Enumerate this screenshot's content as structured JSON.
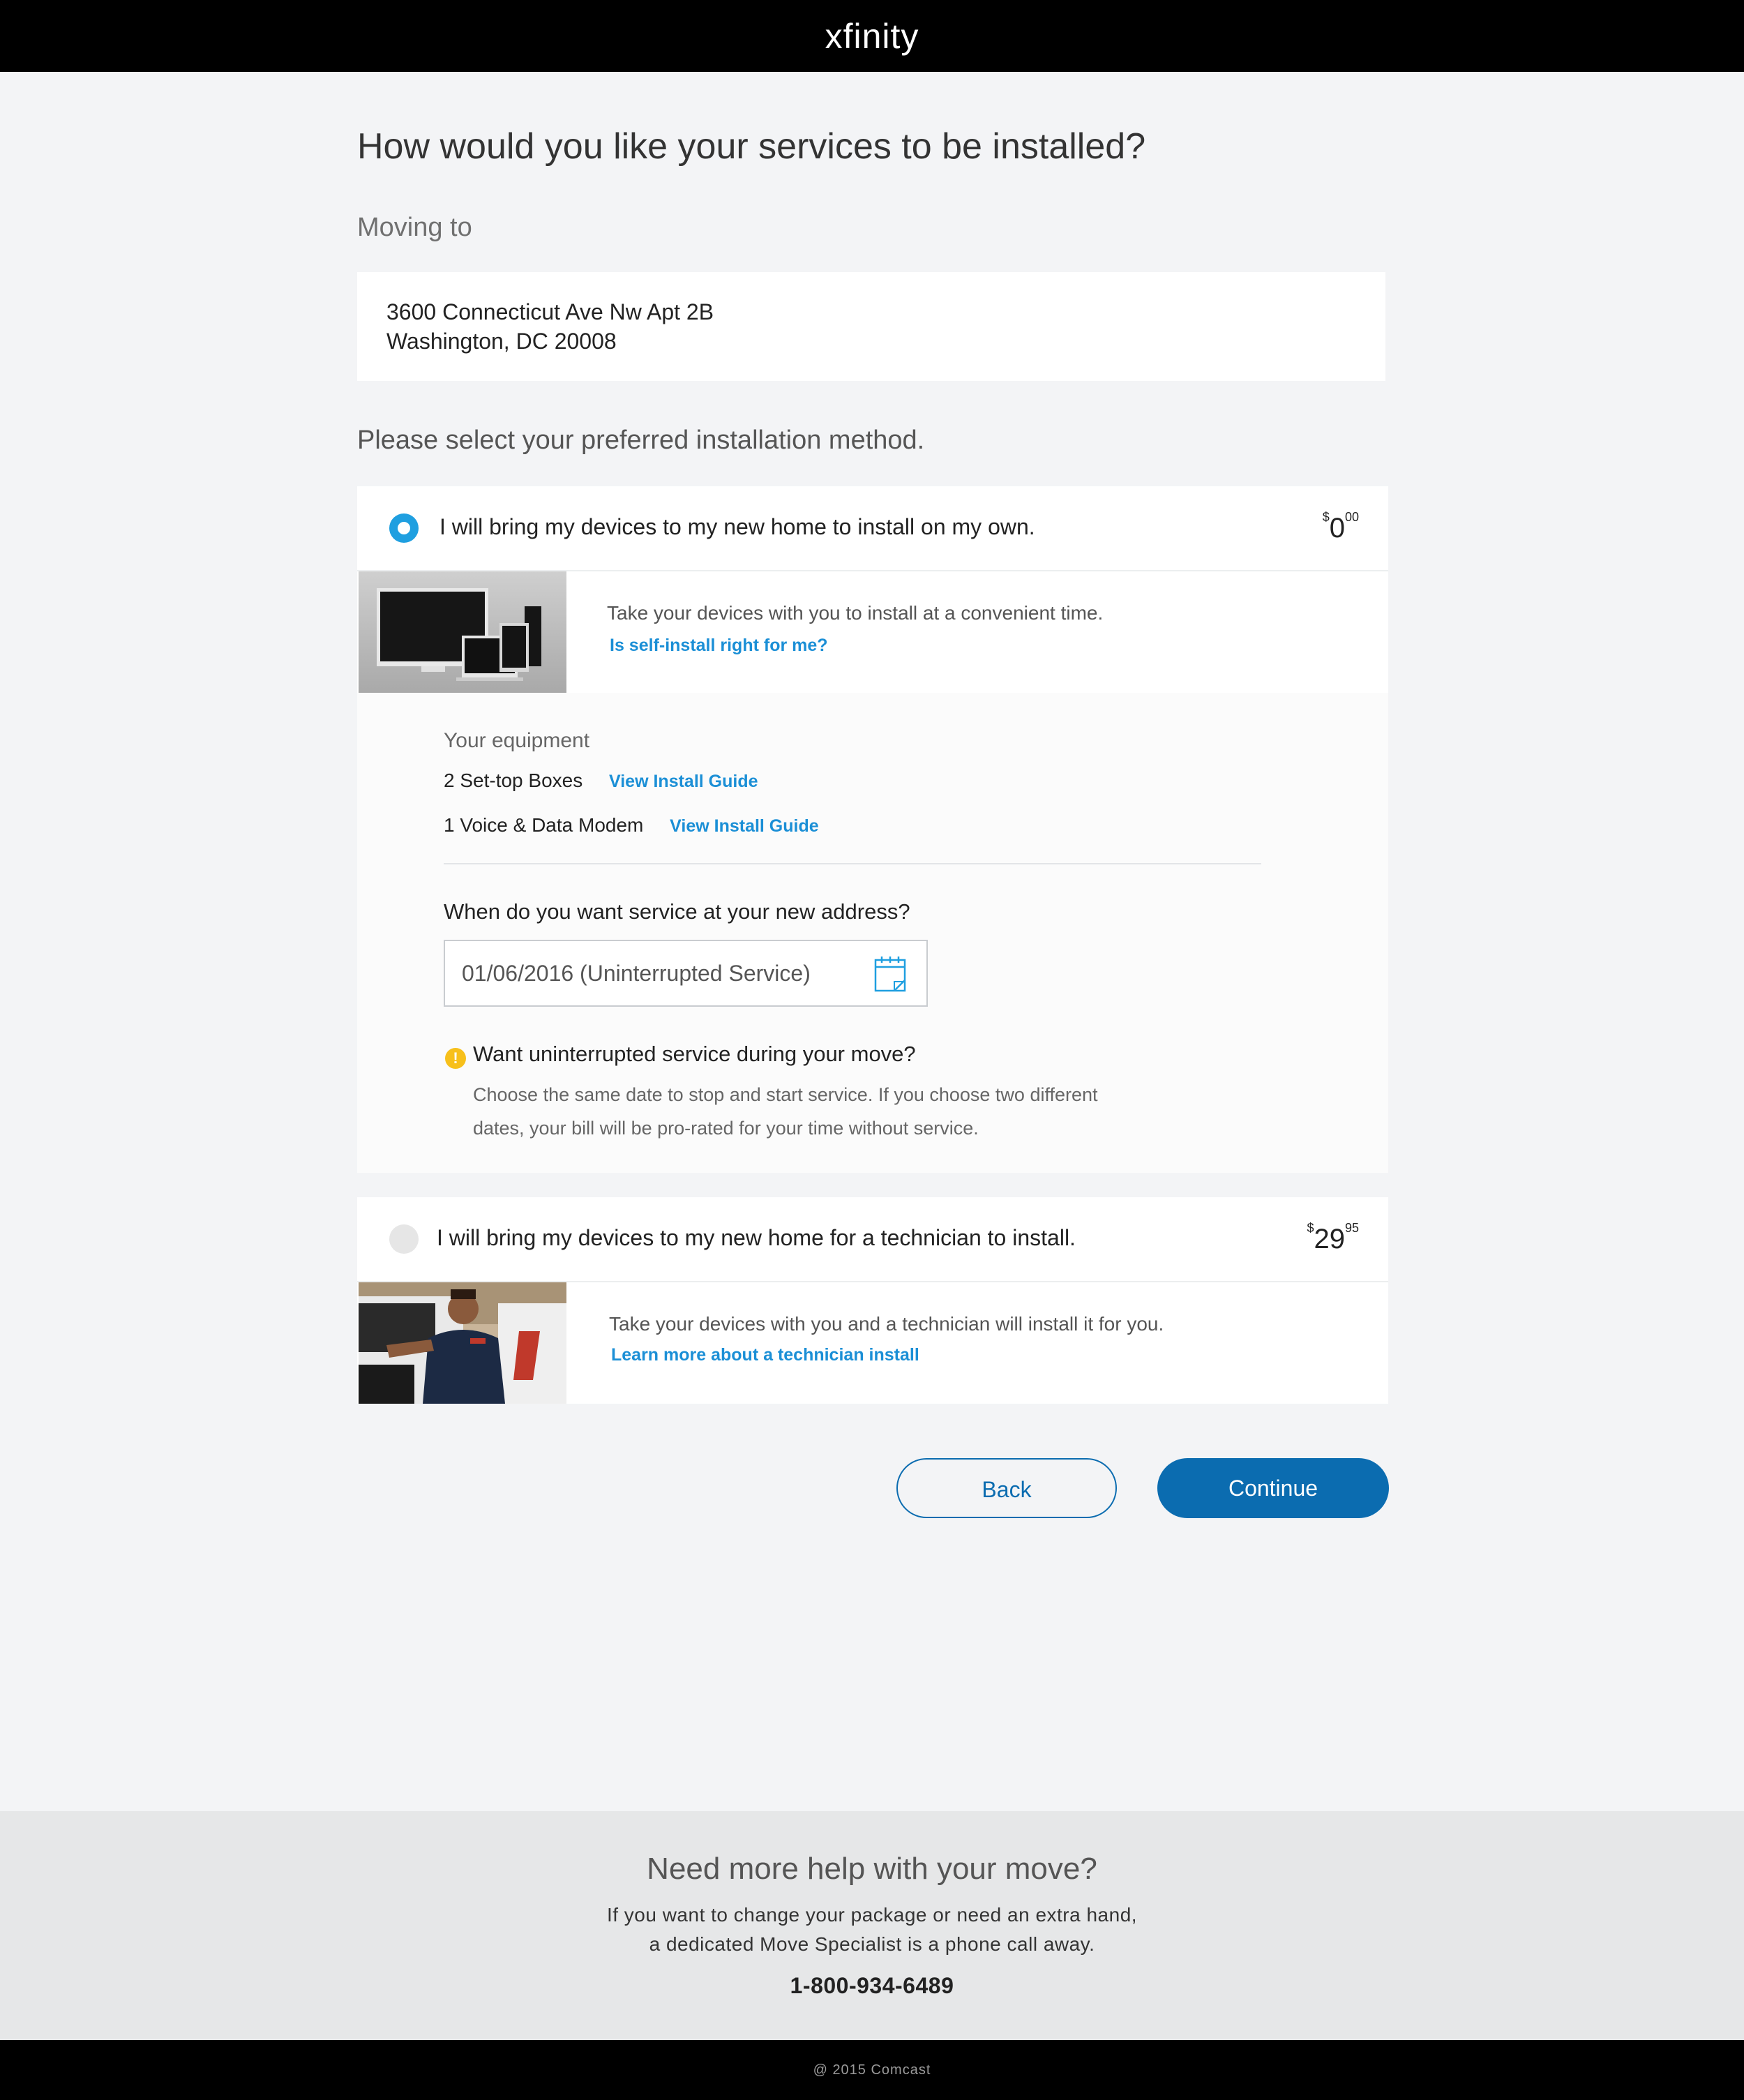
{
  "header": {
    "logo": "xfinity"
  },
  "page": {
    "title": "How would you like your services to be installed?",
    "moving_label": "Moving to",
    "address_line1": "3600 Connecticut Ave Nw Apt 2B",
    "address_line2": "Washington, DC 20008",
    "select_label": "Please select your preferred installation method."
  },
  "options": [
    {
      "label": "I will bring my devices to my new home to install on my own.",
      "price_dollar_sign": "$",
      "price_main": "0",
      "price_cents": "00",
      "selected": true,
      "description": "Take your devices with you to install at a convenient time.",
      "link": "Is self-install right for me?"
    },
    {
      "label": "I will bring my devices to my new home for a technician to install.",
      "price_dollar_sign": "$",
      "price_main": "29",
      "price_cents": "95",
      "selected": false,
      "description": "Take your devices with you and a technician will install it for you.",
      "link": "Learn more about a technician install"
    }
  ],
  "equipment": {
    "title": "Your equipment",
    "items": [
      {
        "name": "2 Set-top Boxes",
        "link": "View Install Guide"
      },
      {
        "name": "1 Voice & Data Modem",
        "link": "View Install Guide"
      }
    ]
  },
  "service_date": {
    "question": "When do you want service at your new address?",
    "value": "01/06/2016 (Uninterrupted Service)"
  },
  "warning": {
    "icon": "!",
    "title": "Want uninterrupted service during your move?",
    "line1": "Choose the same date to stop and start service. If you choose two different",
    "line2": "dates, your bill will be pro-rated for your time without service."
  },
  "buttons": {
    "back": "Back",
    "continue": "Continue"
  },
  "help": {
    "title": "Need more help with your move?",
    "line1": "If you want to change your package or need an extra hand,",
    "line2": "a dedicated Move Specialist is a phone call away.",
    "phone": "1-800-934-6489"
  },
  "footer": {
    "copyright": "@ 2015 Comcast"
  },
  "colors": {
    "accent": "#0b6cb0",
    "link": "#1b8fd6",
    "radio_selected": "#1f9fe0",
    "warning": "#f7c01b"
  },
  "icons": {
    "calendar": "calendar-icon",
    "warning": "warning-icon",
    "radio": "radio-button"
  }
}
